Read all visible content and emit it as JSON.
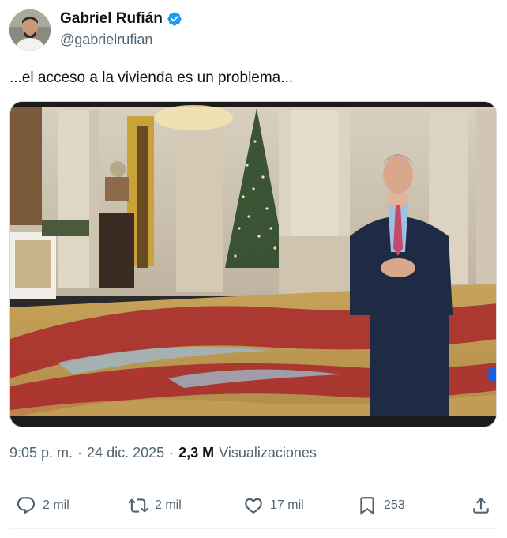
{
  "author": {
    "name": "Gabriel Rufián",
    "handle": "@gabrielrufian"
  },
  "tweet": {
    "text": "...el acceso a la vivienda es un problema..."
  },
  "meta": {
    "time": "9:05 p. m.",
    "separator1": "·",
    "date": "24 dic. 2025",
    "separator2": "·",
    "views_count": "2,3 M",
    "views_label": "Visualizaciones"
  },
  "actions": {
    "replies": "2 mil",
    "reposts": "2 mil",
    "likes": "17 mil",
    "bookmarks": "253"
  },
  "colors": {
    "verified": "#1d9bf0",
    "secondary_text": "#536471",
    "primary_text": "#0f1419"
  }
}
